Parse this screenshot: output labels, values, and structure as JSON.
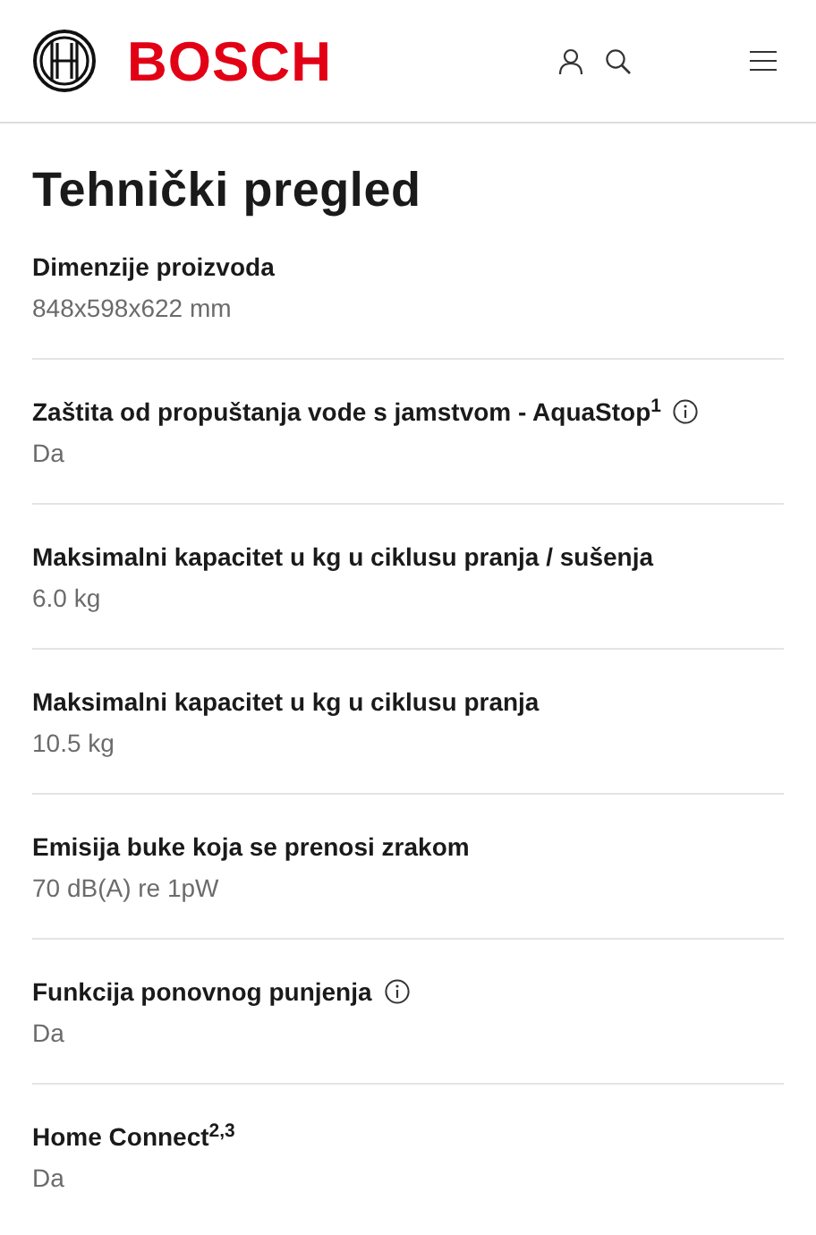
{
  "header": {
    "brand": "BOSCH"
  },
  "title": "Tehnički pregled",
  "specs": [
    {
      "label": "Dimenzije proizvoda",
      "value": "848x598x622 mm",
      "info": false
    },
    {
      "label": "Zaštita od propuštanja vode s jamstvom - AquaStop$^{1}$",
      "value": "Da",
      "info": true
    },
    {
      "label": "Maksimalni kapacitet u kg u ciklusu pranja / sušenja",
      "value": "6.0 kg",
      "info": false
    },
    {
      "label": "Maksimalni kapacitet u kg u ciklusu pranja",
      "value": "10.5 kg",
      "info": false
    },
    {
      "label": "Emisija buke koja se prenosi zrakom",
      "value": "70 dB(A) re 1pW",
      "info": false
    },
    {
      "label": "Funkcija ponovnog punjenja",
      "value": "Da",
      "info": true
    },
    {
      "label": "Home Connect$^{2,3}$",
      "value": "Da",
      "info": false
    }
  ]
}
